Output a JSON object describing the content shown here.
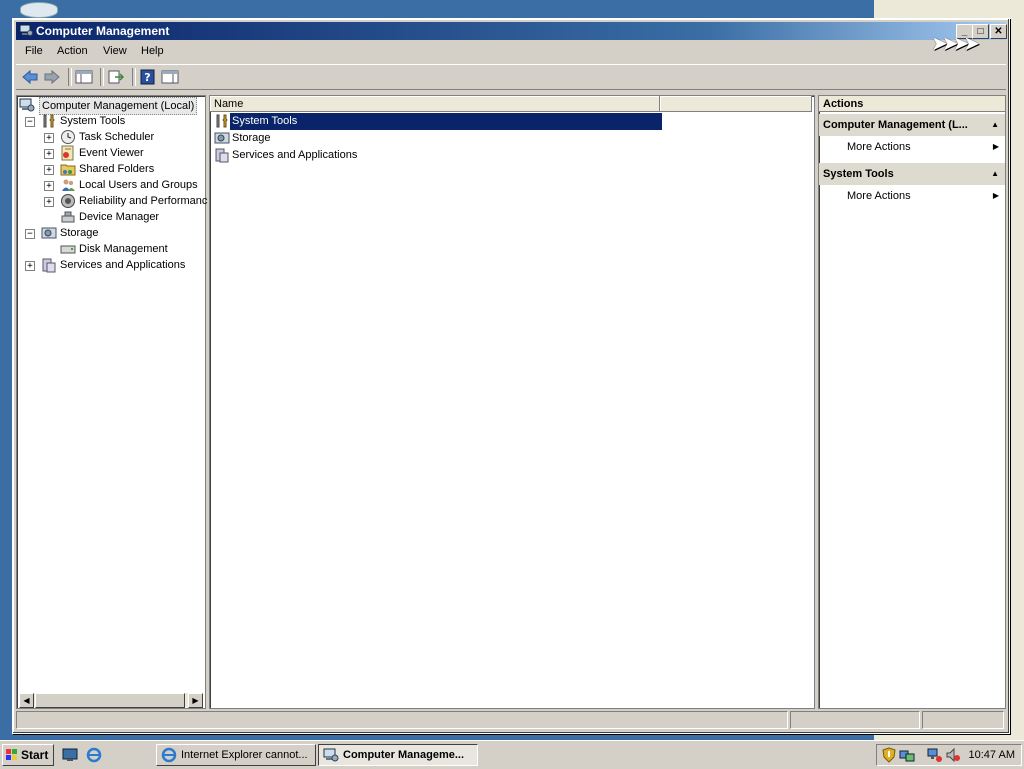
{
  "window": {
    "title": "Computer Management"
  },
  "menu": [
    "File",
    "Action",
    "View",
    "Help"
  ],
  "tree": {
    "root": "Computer Management (Local)",
    "system_tools": "System Tools",
    "task_scheduler": "Task Scheduler",
    "event_viewer": "Event Viewer",
    "shared_folders": "Shared Folders",
    "local_users": "Local Users and Groups",
    "reliability": "Reliability and Performanc",
    "device_manager": "Device Manager",
    "storage": "Storage",
    "disk_management": "Disk Management",
    "services_apps": "Services and Applications"
  },
  "list": {
    "column_name": "Name",
    "items": [
      "System Tools",
      "Storage",
      "Services and Applications"
    ]
  },
  "actions": {
    "header": "Actions",
    "section1": "Computer Management (L...",
    "section1_more": "More Actions",
    "section2": "System Tools",
    "section2_more": "More Actions"
  },
  "taskbar": {
    "start": "Start",
    "task1": "Internet Explorer cannot...",
    "task2": "Computer Manageme...",
    "clock": "10:47 AM"
  },
  "colors": {
    "titlebar": "#0a246a",
    "selection": "#0a246a",
    "desktop": "#3a6ea5"
  }
}
